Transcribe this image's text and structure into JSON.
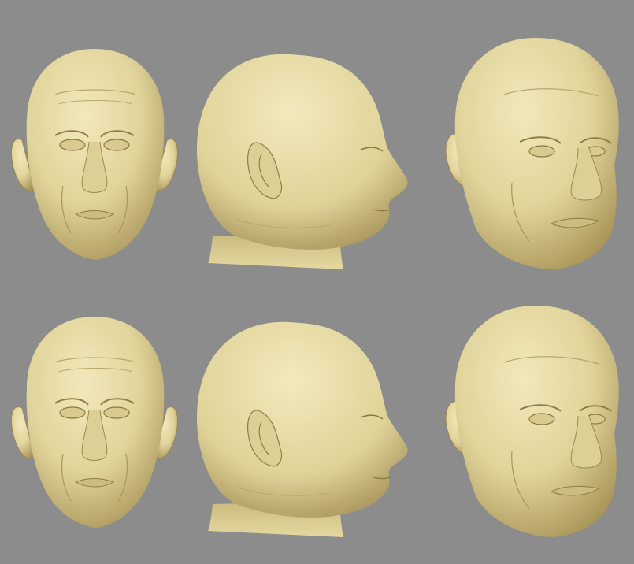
{
  "scene": {
    "background_color": "#8c8c8c",
    "skin_color": "#e6daa0",
    "skin_shadow": "#a38f55",
    "wire_color": "#d8641e"
  },
  "rows": [
    {
      "name": "shaded-row",
      "wireframe": false,
      "views": [
        {
          "name": "front",
          "pose": "front"
        },
        {
          "name": "side",
          "pose": "profile-right"
        },
        {
          "name": "three-quarter",
          "pose": "three-quarter-right"
        }
      ]
    },
    {
      "name": "wireframe-row",
      "wireframe": true,
      "views": [
        {
          "name": "front",
          "pose": "front"
        },
        {
          "name": "side",
          "pose": "profile-right"
        },
        {
          "name": "three-quarter",
          "pose": "three-quarter-right"
        }
      ]
    }
  ]
}
